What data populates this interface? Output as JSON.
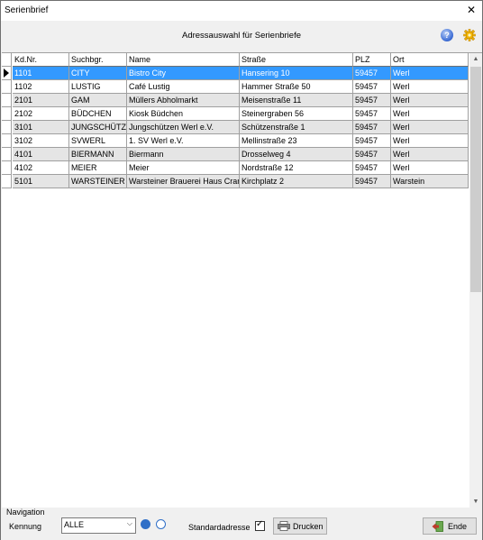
{
  "window": {
    "title": "Serienbrief"
  },
  "header": {
    "title": "Adressauswahl für Serienbriefe"
  },
  "grid": {
    "columns": [
      "Kd.Nr.",
      "Suchbgr.",
      "Name",
      "Straße",
      "PLZ",
      "Ort"
    ],
    "rows": [
      [
        "1101",
        "CITY",
        "Bistro City",
        "Hansering 10",
        "59457",
        "Werl"
      ],
      [
        "1102",
        "LUSTIG",
        "Café Lustig",
        "Hammer Straße 50",
        "59457",
        "Werl"
      ],
      [
        "2101",
        "GAM",
        "Müllers Abholmarkt",
        "Meisenstraße 11",
        "59457",
        "Werl"
      ],
      [
        "2102",
        "BÜDCHEN",
        "Kiosk Büdchen",
        "Steinergraben 56",
        "59457",
        "Werl"
      ],
      [
        "3101",
        "JUNGSCHÜTZ",
        "Jungschützen Werl e.V.",
        "Schützenstraße 1",
        "59457",
        "Werl"
      ],
      [
        "3102",
        "SVWERL",
        "1. SV Werl e.V.",
        "Mellinstraße 23",
        "59457",
        "Werl"
      ],
      [
        "4101",
        "BIERMANN",
        "Biermann",
        "Drosselweg 4",
        "59457",
        "Werl"
      ],
      [
        "4102",
        "MEIER",
        "Meier",
        "Nordstraße 12",
        "59457",
        "Werl"
      ],
      [
        "5101",
        "WARSTEINER",
        "Warsteiner Brauerei Haus Cram",
        "Kirchplatz 2",
        "59457",
        "Warstein"
      ]
    ]
  },
  "bottom": {
    "nav_label": "Navigation",
    "kennung_label": "Kennung",
    "kennung_value": "ALLE",
    "standard_label": "Standardadresse",
    "standard_checked": true,
    "print_label": "Drucken",
    "end_label": "Ende"
  },
  "icons": {
    "help": "help-icon",
    "settings": "gear-icon",
    "printer": "printer-icon",
    "exit": "exit-icon"
  },
  "colors": {
    "selection": "#3399ff",
    "alt_row": "#e5e5e5",
    "radio": "#2f6fc7"
  }
}
